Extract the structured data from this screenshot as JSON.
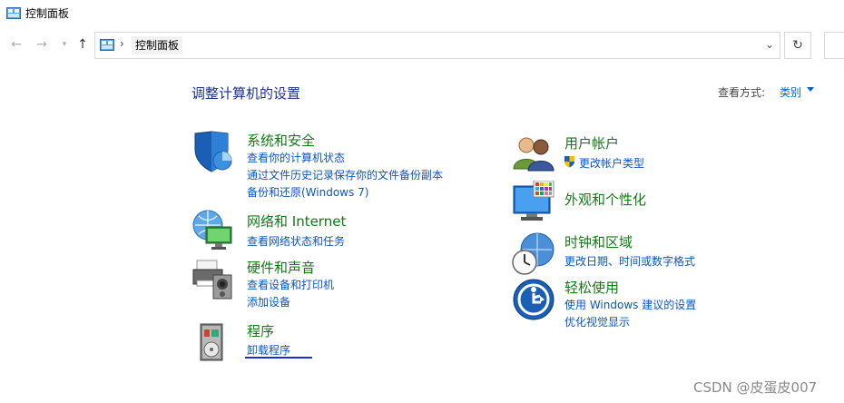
{
  "window": {
    "title": "控制面板"
  },
  "address": {
    "crumb": "控制面板"
  },
  "main": {
    "heading": "调整计算机的设置",
    "view_by_label": "查看方式:",
    "view_by_value": "类别"
  },
  "categories": [
    {
      "title": "系统和安全",
      "links": [
        "查看你的计算机状态",
        "通过文件历史记录保存你的文件备份副本",
        "备份和还原(Windows 7)"
      ]
    },
    {
      "title": "网络和 Internet",
      "links": [
        "查看网络状态和任务"
      ]
    },
    {
      "title": "硬件和声音",
      "links": [
        "查看设备和打印机",
        "添加设备"
      ]
    },
    {
      "title": "程序",
      "links": [
        "卸载程序"
      ]
    },
    {
      "title": "用户帐户",
      "links": [
        "更改帐户类型"
      ]
    },
    {
      "title": "外观和个性化",
      "links": []
    },
    {
      "title": "时钟和区域",
      "links": [
        "更改日期、时间或数字格式"
      ]
    },
    {
      "title": "轻松使用",
      "links": [
        "使用 Windows 建议的设置",
        "优化视觉显示"
      ]
    }
  ],
  "watermark": "CSDN @皮蛋皮007",
  "colors": {
    "category_title": "#127a14",
    "link": "#0b55c8",
    "heading": "#1e3287"
  },
  "icons": {
    "app": "control-panel-icon",
    "back": "back-arrow-icon",
    "forward": "forward-arrow-icon",
    "up": "up-arrow-icon",
    "refresh": "refresh-icon"
  }
}
